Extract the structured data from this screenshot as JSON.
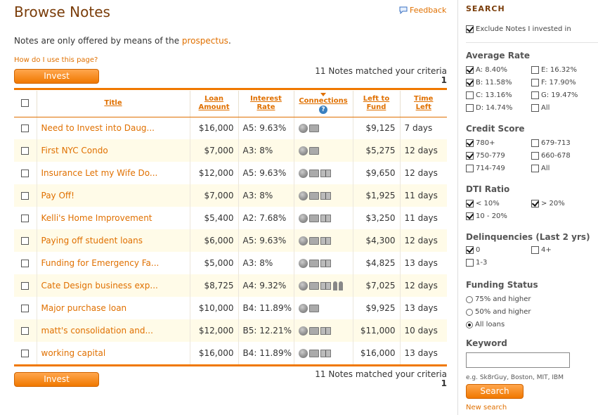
{
  "page": {
    "title": "Browse Notes"
  },
  "feedback": {
    "label": "Feedback"
  },
  "intro": {
    "text": "Notes are only offered by means of the ",
    "link": "prospectus",
    "suffix": "."
  },
  "howto": {
    "label": "How do I use this page?"
  },
  "invest_label": "Invest",
  "results": {
    "matched": "11 Notes matched your criteria",
    "page": "1"
  },
  "table": {
    "headers": {
      "title": "Title",
      "amount_1": "Loan",
      "amount_2": "Amount",
      "rate_1": "Interest",
      "rate_2": "Rate",
      "connections": "Connections",
      "left_1": "Left to",
      "left_2": "Fund",
      "time_1": "Time",
      "time_2": "Left"
    },
    "rows": [
      {
        "title": "Need to Invest into Daug...",
        "amount": "$16,000",
        "rate": "A5: 9.63%",
        "icons": [
          "globe",
          "folder"
        ],
        "left": "$9,125",
        "time": "7 days"
      },
      {
        "title": "First NYC Condo",
        "amount": "$7,000",
        "rate": "A3: 8%",
        "icons": [
          "globe",
          "folder"
        ],
        "left": "$5,275",
        "time": "12 days"
      },
      {
        "title": "Insurance Let my Wife Do...",
        "amount": "$12,000",
        "rate": "A5: 9.63%",
        "icons": [
          "globe",
          "folder",
          "book"
        ],
        "left": "$9,650",
        "time": "12 days"
      },
      {
        "title": "Pay Off!",
        "amount": "$7,000",
        "rate": "A3: 8%",
        "icons": [
          "globe",
          "folder",
          "book"
        ],
        "left": "$1,925",
        "time": "11 days"
      },
      {
        "title": "Kelli's Home Improvement",
        "amount": "$5,400",
        "rate": "A2: 7.68%",
        "icons": [
          "globe",
          "folder",
          "book"
        ],
        "left": "$3,250",
        "time": "11 days"
      },
      {
        "title": "Paying off student loans",
        "amount": "$6,000",
        "rate": "A5: 9.63%",
        "icons": [
          "globe",
          "folder",
          "book"
        ],
        "left": "$4,300",
        "time": "12 days"
      },
      {
        "title": "Funding for Emergency Fa...",
        "amount": "$5,000",
        "rate": "A3: 8%",
        "icons": [
          "globe",
          "folder",
          "book"
        ],
        "left": "$4,825",
        "time": "13 days"
      },
      {
        "title": "Cate Design business exp...",
        "amount": "$8,725",
        "rate": "A4: 9.32%",
        "icons": [
          "globe",
          "folder",
          "book",
          "people"
        ],
        "left": "$7,025",
        "time": "12 days"
      },
      {
        "title": "Major purchase loan",
        "amount": "$10,000",
        "rate": "B4: 11.89%",
        "icons": [
          "globe",
          "folder"
        ],
        "left": "$9,925",
        "time": "13 days"
      },
      {
        "title": "matt's consolidation and...",
        "amount": "$12,000",
        "rate": "B5: 12.21%",
        "icons": [
          "globe",
          "folder",
          "book"
        ],
        "left": "$11,000",
        "time": "10 days"
      },
      {
        "title": "working capital",
        "amount": "$16,000",
        "rate": "B4: 11.89%",
        "icons": [
          "globe",
          "folder",
          "book"
        ],
        "left": "$16,000",
        "time": "13 days"
      }
    ]
  },
  "sidebar": {
    "title": "Search",
    "exclude": {
      "label": "Exclude Notes I invested in",
      "checked": true
    },
    "avg_rate": {
      "heading": "Average Rate",
      "options": [
        {
          "label": "A: 8.40%",
          "checked": true
        },
        {
          "label": "E: 16.32%",
          "checked": false
        },
        {
          "label": "B: 11.58%",
          "checked": true
        },
        {
          "label": "F: 17.90%",
          "checked": false
        },
        {
          "label": "C: 13.16%",
          "checked": false
        },
        {
          "label": "G: 19.47%",
          "checked": false
        },
        {
          "label": "D: 14.74%",
          "checked": false
        },
        {
          "label": "All",
          "checked": false
        }
      ]
    },
    "credit": {
      "heading": "Credit Score",
      "options": [
        {
          "label": "780+",
          "checked": true
        },
        {
          "label": "679-713",
          "checked": false
        },
        {
          "label": "750-779",
          "checked": true
        },
        {
          "label": "660-678",
          "checked": false
        },
        {
          "label": "714-749",
          "checked": false
        },
        {
          "label": "All",
          "checked": false
        }
      ]
    },
    "dti": {
      "heading": "DTI Ratio",
      "options": [
        {
          "label": "< 10%",
          "checked": true
        },
        {
          "label": "> 20%",
          "checked": true
        },
        {
          "label": "10 - 20%",
          "checked": true
        }
      ]
    },
    "delinq": {
      "heading": "Delinquencies (Last 2 yrs)",
      "options": [
        {
          "label": "0",
          "checked": true
        },
        {
          "label": "4+",
          "checked": false
        },
        {
          "label": "1-3",
          "checked": false
        }
      ]
    },
    "funding": {
      "heading": "Funding Status",
      "options": [
        {
          "label": "75% and higher",
          "selected": false
        },
        {
          "label": "50% and higher",
          "selected": false
        },
        {
          "label": "All loans",
          "selected": true
        }
      ]
    },
    "keyword": {
      "heading": "Keyword",
      "value": "",
      "hint": "e.g. Sk8rGuy, Boston, MIT, IBM"
    },
    "search_label": "Search",
    "new_search": "New search"
  },
  "colors": {
    "accent": "#f07800",
    "title_brown": "#7a3d0a",
    "row_alt": "#fffbe8"
  }
}
